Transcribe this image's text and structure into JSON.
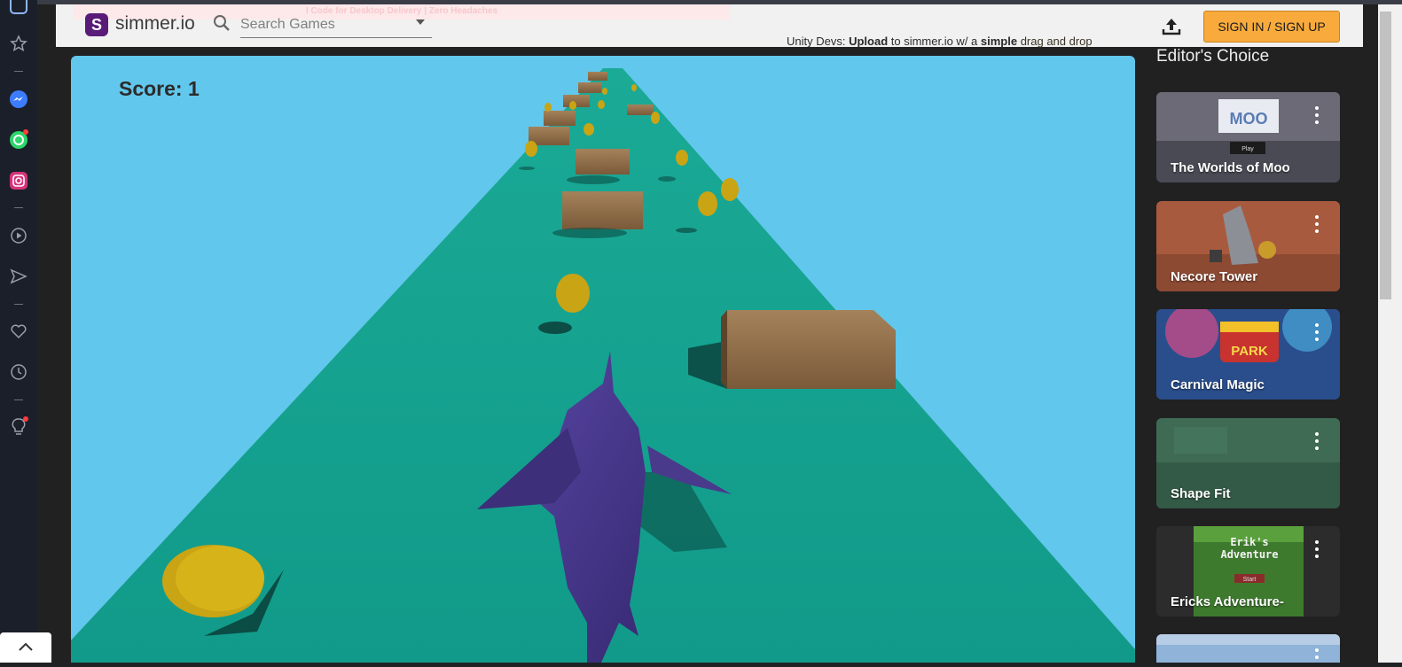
{
  "dock": {
    "items": [
      "browser-icon",
      "bookmarks-icon",
      "messenger-icon",
      "whatsapp-icon",
      "instagram-icon",
      "player-icon",
      "send-icon",
      "heart-icon",
      "history-icon",
      "tips-icon",
      "more-icon"
    ]
  },
  "header": {
    "promo_text": "I Code for Desktop Delivery | Zero Headaches",
    "logo_letter": "S",
    "site_name": "simmer.io",
    "search_placeholder": "Search Games",
    "signin_label": "SIGN IN / SIGN UP"
  },
  "dev_banner": {
    "prefix": "Unity Devs: ",
    "bold1": "Upload",
    "middle": " to simmer.io w/ a ",
    "bold2": "simple",
    "suffix": " drag and drop"
  },
  "game": {
    "score_text": "Score: 1"
  },
  "sidebar": {
    "title": "Editor's Choice",
    "cards": [
      {
        "title": "The Worlds of Moo",
        "thumb_text": "MOO",
        "thumb_sub": "Play",
        "colors": [
          "#4a4a55",
          "#7d7a86"
        ]
      },
      {
        "title": "Necore Tower",
        "thumb_text": "",
        "thumb_sub": "",
        "colors": [
          "#8b4b35",
          "#c06a4b"
        ]
      },
      {
        "title": "Carnival Magic",
        "thumb_text": "PARK",
        "thumb_sub": "",
        "colors": [
          "#2a4e8c",
          "#d84b87"
        ]
      },
      {
        "title": "Shape Fit",
        "thumb_text": "",
        "thumb_sub": "",
        "colors": [
          "#3f6b55",
          "#2f5042"
        ]
      },
      {
        "title": "Ericks Adventure-",
        "thumb_text": "Erik's Adventure",
        "thumb_sub": "Start",
        "colors": [
          "#2c2c2c",
          "#3e7a2e"
        ]
      },
      {
        "title": "",
        "thumb_text": "",
        "thumb_sub": "",
        "colors": [
          "#8fb3d9",
          "#c5d6ea"
        ]
      }
    ]
  },
  "colors": {
    "sky": "#62c7ec",
    "track": "#14a08f",
    "shark": "#4a3a8c",
    "coin": "#c9a414",
    "crate": "#8a6a45",
    "accent": "#f8ab3c"
  }
}
